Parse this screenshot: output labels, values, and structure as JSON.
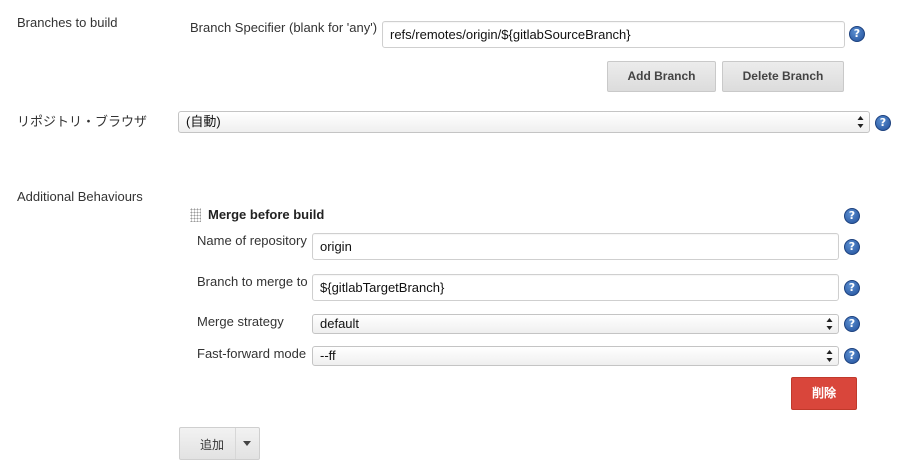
{
  "branches": {
    "section_label": "Branches to build",
    "specifier_label": "Branch Specifier (blank for 'any')",
    "specifier_value": "refs/remotes/origin/${gitlabSourceBranch}",
    "add_branch_label": "Add Branch",
    "delete_branch_label": "Delete Branch"
  },
  "repository_browser": {
    "label": "リポジトリ・ブラウザ",
    "selected": "(自動)"
  },
  "additional_behaviours": {
    "label": "Additional Behaviours",
    "merge_before_build": {
      "title": "Merge before build",
      "repo_name_label": "Name of repository",
      "repo_name_value": "origin",
      "branch_label": "Branch to merge to",
      "branch_value": "${gitlabTargetBranch}",
      "strategy_label": "Merge strategy",
      "strategy_selected": "default",
      "ff_label": "Fast-forward mode",
      "ff_selected": "--ff",
      "delete_label": "削除"
    },
    "add_label": "追加"
  },
  "icons": {
    "help": "question-mark-help-icon",
    "drag": "drag-handle-icon",
    "select_arrows": "up-down-arrows-icon",
    "dropdown": "caret-down-icon"
  },
  "colors": {
    "help_icon": "#2a5ba8",
    "danger_button": "#d9463b"
  }
}
